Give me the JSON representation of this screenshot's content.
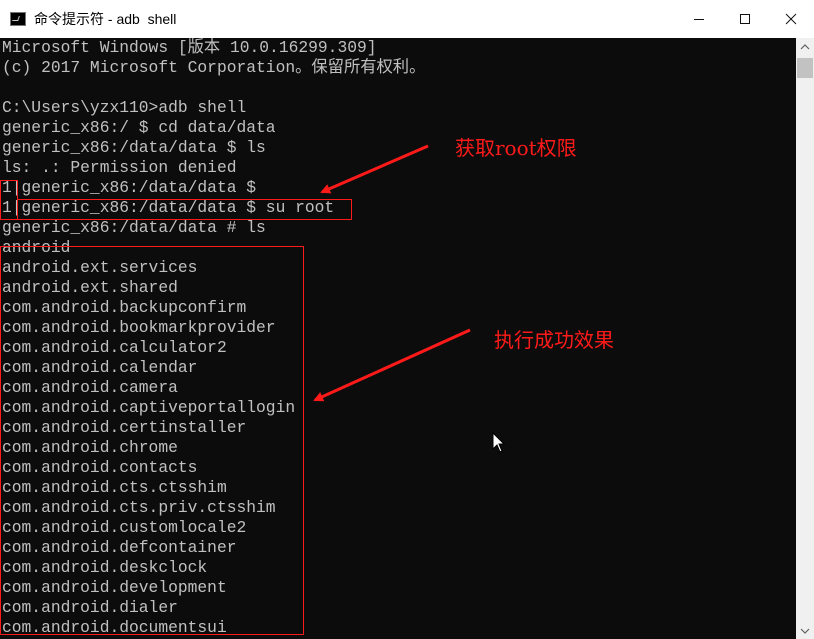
{
  "window": {
    "title": "命令提示符 - adb  shell",
    "controls": {
      "minimize": "—",
      "maximize": "☐",
      "close": "✕"
    }
  },
  "console": {
    "lines": [
      "Microsoft Windows [版本 10.0.16299.309]",
      "(c) 2017 Microsoft Corporation。保留所有权利。",
      "",
      "C:\\Users\\yzx110>adb shell",
      "generic_x86:/ $ cd data/data",
      "generic_x86:/data/data $ ls",
      "ls: .: Permission denied",
      "1|generic_x86:/data/data $",
      "1|generic_x86:/data/data $ su root",
      "generic_x86:/data/data # ls",
      "android",
      "android.ext.services",
      "android.ext.shared",
      "com.android.backupconfirm",
      "com.android.bookmarkprovider",
      "com.android.calculator2",
      "com.android.calendar",
      "com.android.camera",
      "com.android.captiveportallogin",
      "com.android.certinstaller",
      "com.android.chrome",
      "com.android.contacts",
      "com.android.cts.ctsshim",
      "com.android.cts.priv.ctsshim",
      "com.android.customlocale2",
      "com.android.defcontainer",
      "com.android.deskclock",
      "com.android.development",
      "com.android.dialer",
      "com.android.documentsui"
    ]
  },
  "annotations": {
    "root_note": "获取root权限",
    "result_note": "执行成功效果"
  },
  "colors": {
    "console_bg": "#0c0c0c",
    "console_text": "#c0c0c0",
    "annotation": "#ff1a1a",
    "titlebar_bg": "#ffffff"
  },
  "icons": {
    "app": "cmd-icon",
    "cursor": "mouse-pointer-icon"
  }
}
